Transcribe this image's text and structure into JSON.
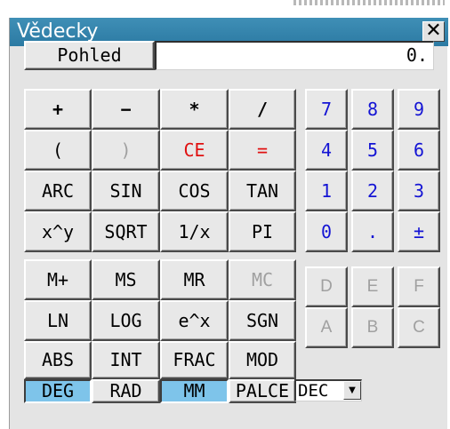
{
  "window": {
    "title": "Vědecky",
    "close_symbol": "✕"
  },
  "view_button": {
    "label": "Pohled"
  },
  "display": {
    "value": "0."
  },
  "operators": [
    "+",
    "−",
    "*",
    "/"
  ],
  "bracket_row": [
    "(",
    ")",
    "CE",
    "="
  ],
  "functions": {
    "row1": [
      "ARC",
      "SIN",
      "COS",
      "TAN"
    ],
    "row2": [
      "x^y",
      "SQRT",
      "1/x",
      "PI"
    ],
    "row3": [
      "M+",
      "MS",
      "MR",
      "MC"
    ],
    "row4": [
      "LN",
      "LOG",
      "e^x",
      "SGN"
    ],
    "row5": [
      "ABS",
      "INT",
      "FRAC",
      "MOD"
    ]
  },
  "keypad": {
    "row1": [
      "7",
      "8",
      "9"
    ],
    "row2": [
      "4",
      "5",
      "6"
    ],
    "row3": [
      "1",
      "2",
      "3"
    ],
    "row4": [
      "0",
      ".",
      "±"
    ],
    "row5": [
      "D",
      "E",
      "F"
    ],
    "row6": [
      "A",
      "B",
      "C"
    ]
  },
  "angle_modes": [
    "DEG",
    "RAD"
  ],
  "unit_modes": [
    "MM",
    "PALCE"
  ],
  "angle_mode_selected": "DEG",
  "unit_mode_selected": "MM",
  "number_base": {
    "value": "DEC",
    "arrow": "▼"
  },
  "colors": {
    "title_bar": "#2f7faa",
    "digit_text": "#1414d4",
    "clear_text": "#e01010",
    "selected_mode": "#7ec4ea",
    "disabled_text": "#a0a0a0"
  }
}
